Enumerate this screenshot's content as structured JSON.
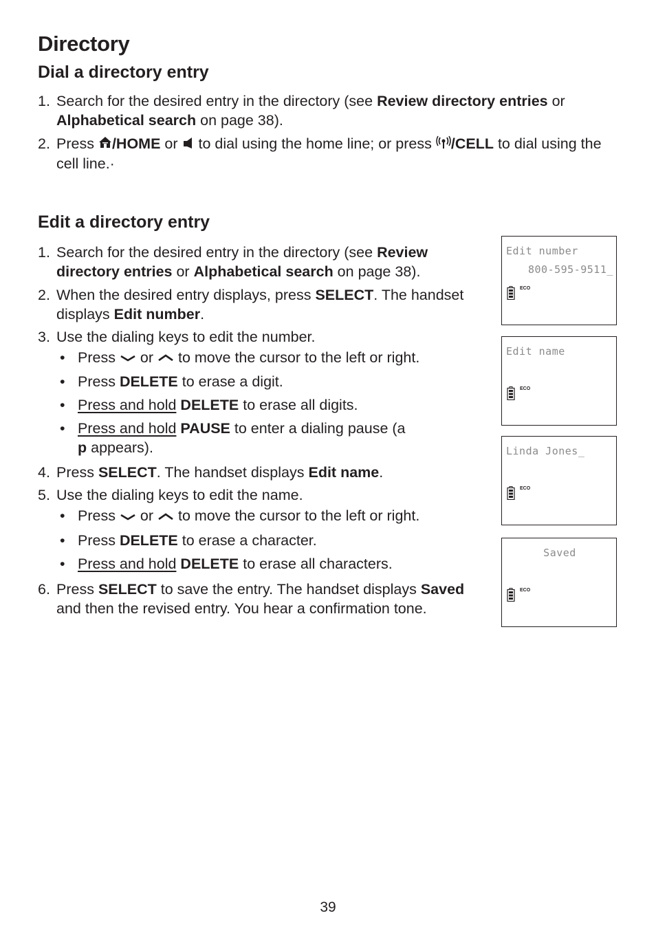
{
  "page_title": "Directory",
  "dial_section": {
    "title": "Dial a directory entry",
    "steps": [
      {
        "num": "1.",
        "t1": "Search for the desired entry in the directory (see ",
        "b1": "Review directory entries",
        "t2": " or ",
        "b2": "Alphabetical search",
        "t3": " on page 38)."
      },
      {
        "num": "2.",
        "t1": "Press ",
        "home_icon": "home-icon",
        "b1": "/HOME",
        "t2": " or ",
        "speaker_icon": "speaker-icon",
        "t3": " to dial using the home line; or press ",
        "cell_icon": "cell-antenna-icon",
        "b2": "/CELL",
        "t4": " to dial using the cell line.·"
      }
    ]
  },
  "edit_section": {
    "title": "Edit a directory entry",
    "steps": [
      {
        "num": "1.",
        "t1": "Search for the desired entry in the directory (see ",
        "b1": "Review directory entries",
        "t2": " or ",
        "b2": "Alphabetical search",
        "t3": " on page 38)."
      },
      {
        "num": "2.",
        "t1": "When the desired entry displays, press ",
        "b1": "SELECT",
        "t2": ". The handset displays ",
        "b2": "Edit number",
        "t3": "."
      },
      {
        "num": "3.",
        "t1": "Use the dialing keys to edit the number.",
        "bullets": [
          {
            "t1": "Press ",
            "icon1": "down-arrow-icon",
            "t2": " or ",
            "icon2": "up-arrow-icon",
            "t3": " to move the cursor to the left or right."
          },
          {
            "t1": "Press ",
            "b1": "DELETE",
            "t2": " to erase a digit."
          },
          {
            "u1": "Press and hold",
            "t1": " ",
            "b1": "DELETE",
            "t2": " to erase all digits."
          },
          {
            "u1": "Press and hold",
            "t1": " ",
            "b1": "PAUSE",
            "t2": " to enter a dialing pause (a ",
            "b2": "p",
            "t3": " appears)."
          }
        ]
      },
      {
        "num": "4.",
        "t1": "Press ",
        "b1": "SELECT",
        "t2": ". The handset displays ",
        "b2": "Edit name",
        "t3": "."
      },
      {
        "num": "5.",
        "t1": "Use the dialing keys to edit the name.",
        "bullets": [
          {
            "t1": "Press ",
            "icon1": "down-arrow-icon",
            "t2": " or ",
            "icon2": "up-arrow-icon",
            "t3": " to move the cursor to the left or right."
          },
          {
            "t1": "Press ",
            "b1": "DELETE",
            "t2": " to erase a character."
          },
          {
            "u1": "Press and hold",
            "t1": " ",
            "b1": "DELETE",
            "t2": " to erase all characters."
          }
        ]
      },
      {
        "num": "6.",
        "t1": "Press ",
        "b1": "SELECT",
        "t2": " to save the entry. The handset displays ",
        "b2": "Saved",
        "t3": " and then the revised entry. You hear a confirmation tone."
      }
    ]
  },
  "screens": [
    {
      "line1": "Edit number",
      "line2": "800-595-9511_",
      "status": "ECO",
      "battery_icon": "battery-icon"
    },
    {
      "line1": "Edit name",
      "line2": "",
      "status": "ECO",
      "battery_icon": "battery-icon"
    },
    {
      "line1": "Linda Jones_",
      "line2": "",
      "status": "ECO",
      "battery_icon": "battery-icon"
    },
    {
      "line1": "Saved",
      "line2": "",
      "status": "ECO",
      "battery_icon": "battery-icon"
    }
  ],
  "page_number": "39"
}
